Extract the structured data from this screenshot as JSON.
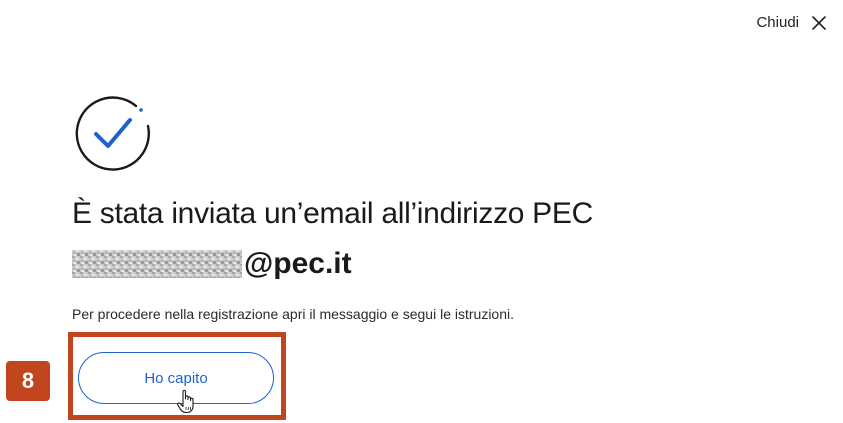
{
  "header": {
    "close_label": "Chiudi",
    "close_icon": "close-icon"
  },
  "status_icon": "check-circle-icon",
  "main": {
    "title": "È stata inviata un’email all’indirizzo PEC",
    "email_domain": "@pec.it",
    "instructions": "Per procedere nella registrazione apri il messaggio e segui le istruzioni.",
    "confirm_button": "Ho capito"
  },
  "annotation": {
    "step_number": "8"
  },
  "colors": {
    "accent": "#1f63c8",
    "highlight": "#c2461d"
  }
}
